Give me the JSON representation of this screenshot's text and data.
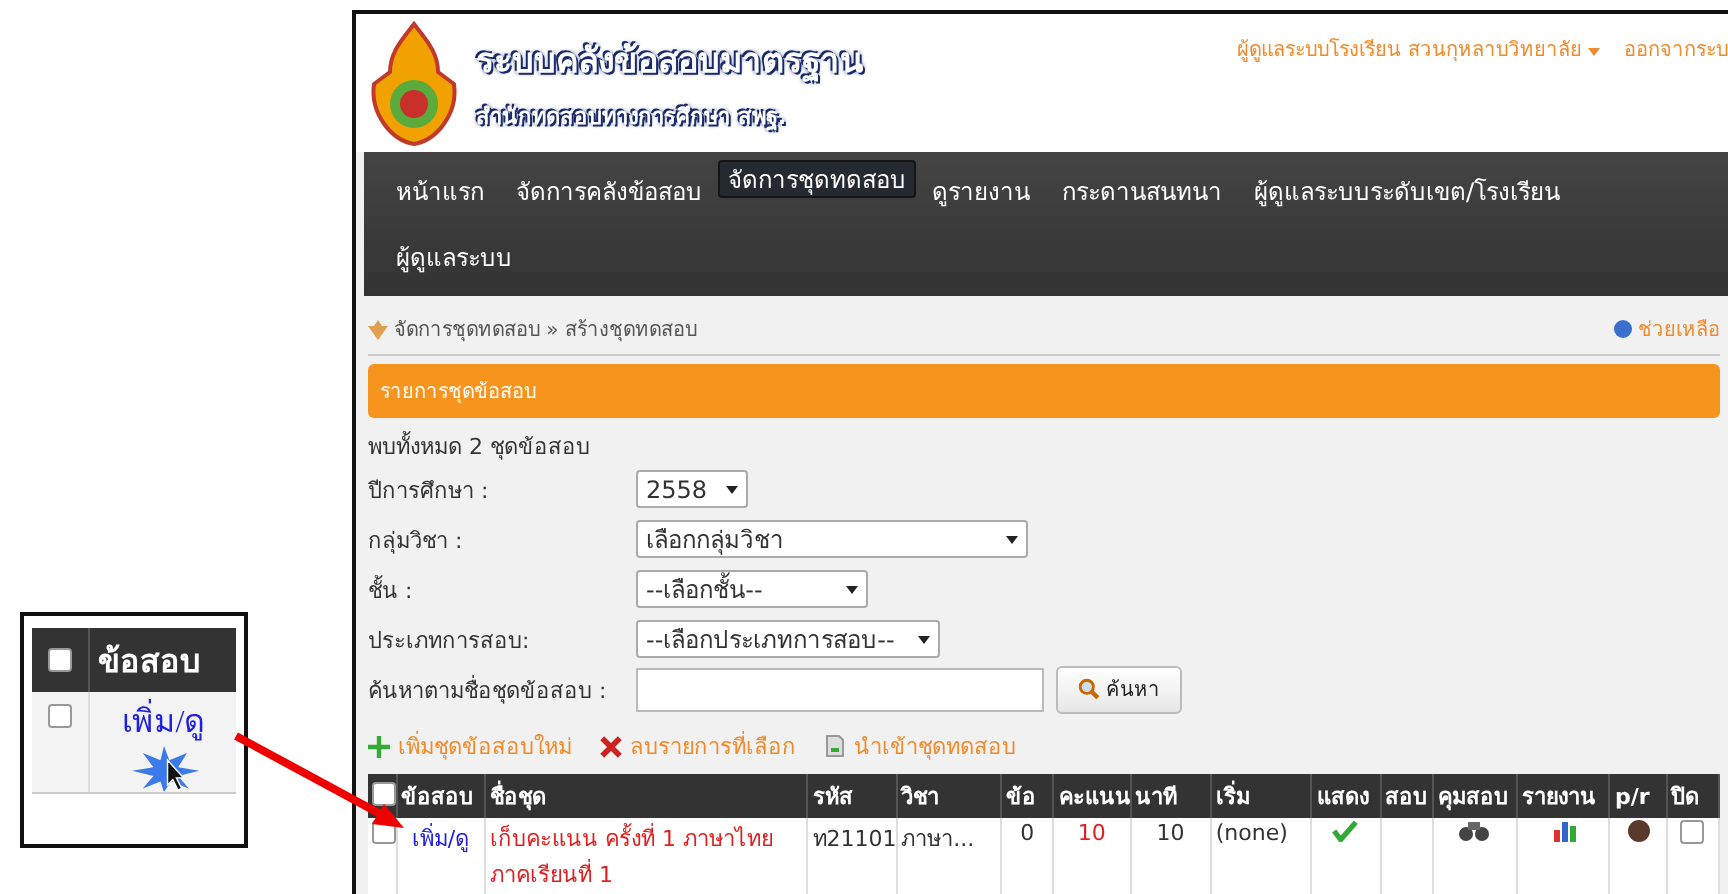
{
  "callout": {
    "header": "ข้อสอบ",
    "header_checked": false,
    "row_checked": false,
    "link": "เพิ่ม/ดู"
  },
  "header": {
    "title": "ระบบคลังข้อสอบมาตรฐาน",
    "subtitle": "สำนักทดสอบทางการศึกษา สพฐ.",
    "user_menu": "ผู้ดูแลระบบโรงเรียน สวนกุหลาบวิทยาลัย",
    "logout": "ออกจากระบ"
  },
  "nav": [
    {
      "label": "หน้าแรก",
      "selected": false
    },
    {
      "label": "จัดการคลังข้อสอบ",
      "selected": false
    },
    {
      "label": "จัดการชุดทดสอบ",
      "selected": true
    },
    {
      "label": "ดูรายงาน",
      "selected": false
    },
    {
      "label": "กระดานสนทนา",
      "selected": false
    },
    {
      "label": "ผู้ดูแลระบบระดับเขต/โรงเรียน",
      "selected": false
    },
    {
      "label": "ผู้ดูแลระบบ",
      "selected": false
    }
  ],
  "breadcrumb": "จัดการชุดทดสอบ » สร้างชุดทดสอบ",
  "help": "ช่วยเหลือ",
  "panel_title": "รายการชุดข้อสอบ",
  "count": "พบทั้งหมด 2 ชุดข้อสอบ",
  "filters": [
    {
      "label": "ปีการศึกษา :",
      "kind": "select",
      "value": "2558"
    },
    {
      "label": "กลุ่มวิชา :",
      "kind": "select",
      "value": "เลือกกลุ่มวิชา"
    },
    {
      "label": "ชั้น :",
      "kind": "select",
      "value": "--เลือกชั้น--"
    },
    {
      "label": "ประเภทการสอบ:",
      "kind": "select",
      "value": "--เลือกประเภทการสอบ--"
    },
    {
      "label": "ค้นหาตามชื่อชุดข้อสอบ :",
      "kind": "text"
    }
  ],
  "search_button": "ค้นหา",
  "actions": [
    {
      "label": "เพิ่มชุดข้อสอบใหม่",
      "kind": "add"
    },
    {
      "label": "ลบรายการที่เลือก",
      "kind": "delete"
    },
    {
      "label": "นำเข้าชุดทดสอบ",
      "kind": "import"
    }
  ],
  "table": {
    "select_all_checked": false,
    "columns": [
      "ข้อสอบ",
      "ชื่อชุด",
      "รหัส",
      "วิชา",
      "ข้อ",
      "คะแนน",
      "นาที",
      "เริ่ม",
      "แสดง",
      "สอบ",
      "คุมสอบ",
      "รายงาน",
      "p/r",
      "ปิด"
    ],
    "rows": [
      {
        "checked": false,
        "exams": "เพิ่ม/ดู",
        "name": "เก็บคะแนน ครั้งที่ 1 ภาษาไทย ภาคเรียนที่ 1",
        "code": "ท21101",
        "subject": "ภาษา...",
        "items": "0",
        "score": "10",
        "minutes": "10",
        "start": "(none)",
        "shown": true,
        "closed": false
      }
    ]
  }
}
